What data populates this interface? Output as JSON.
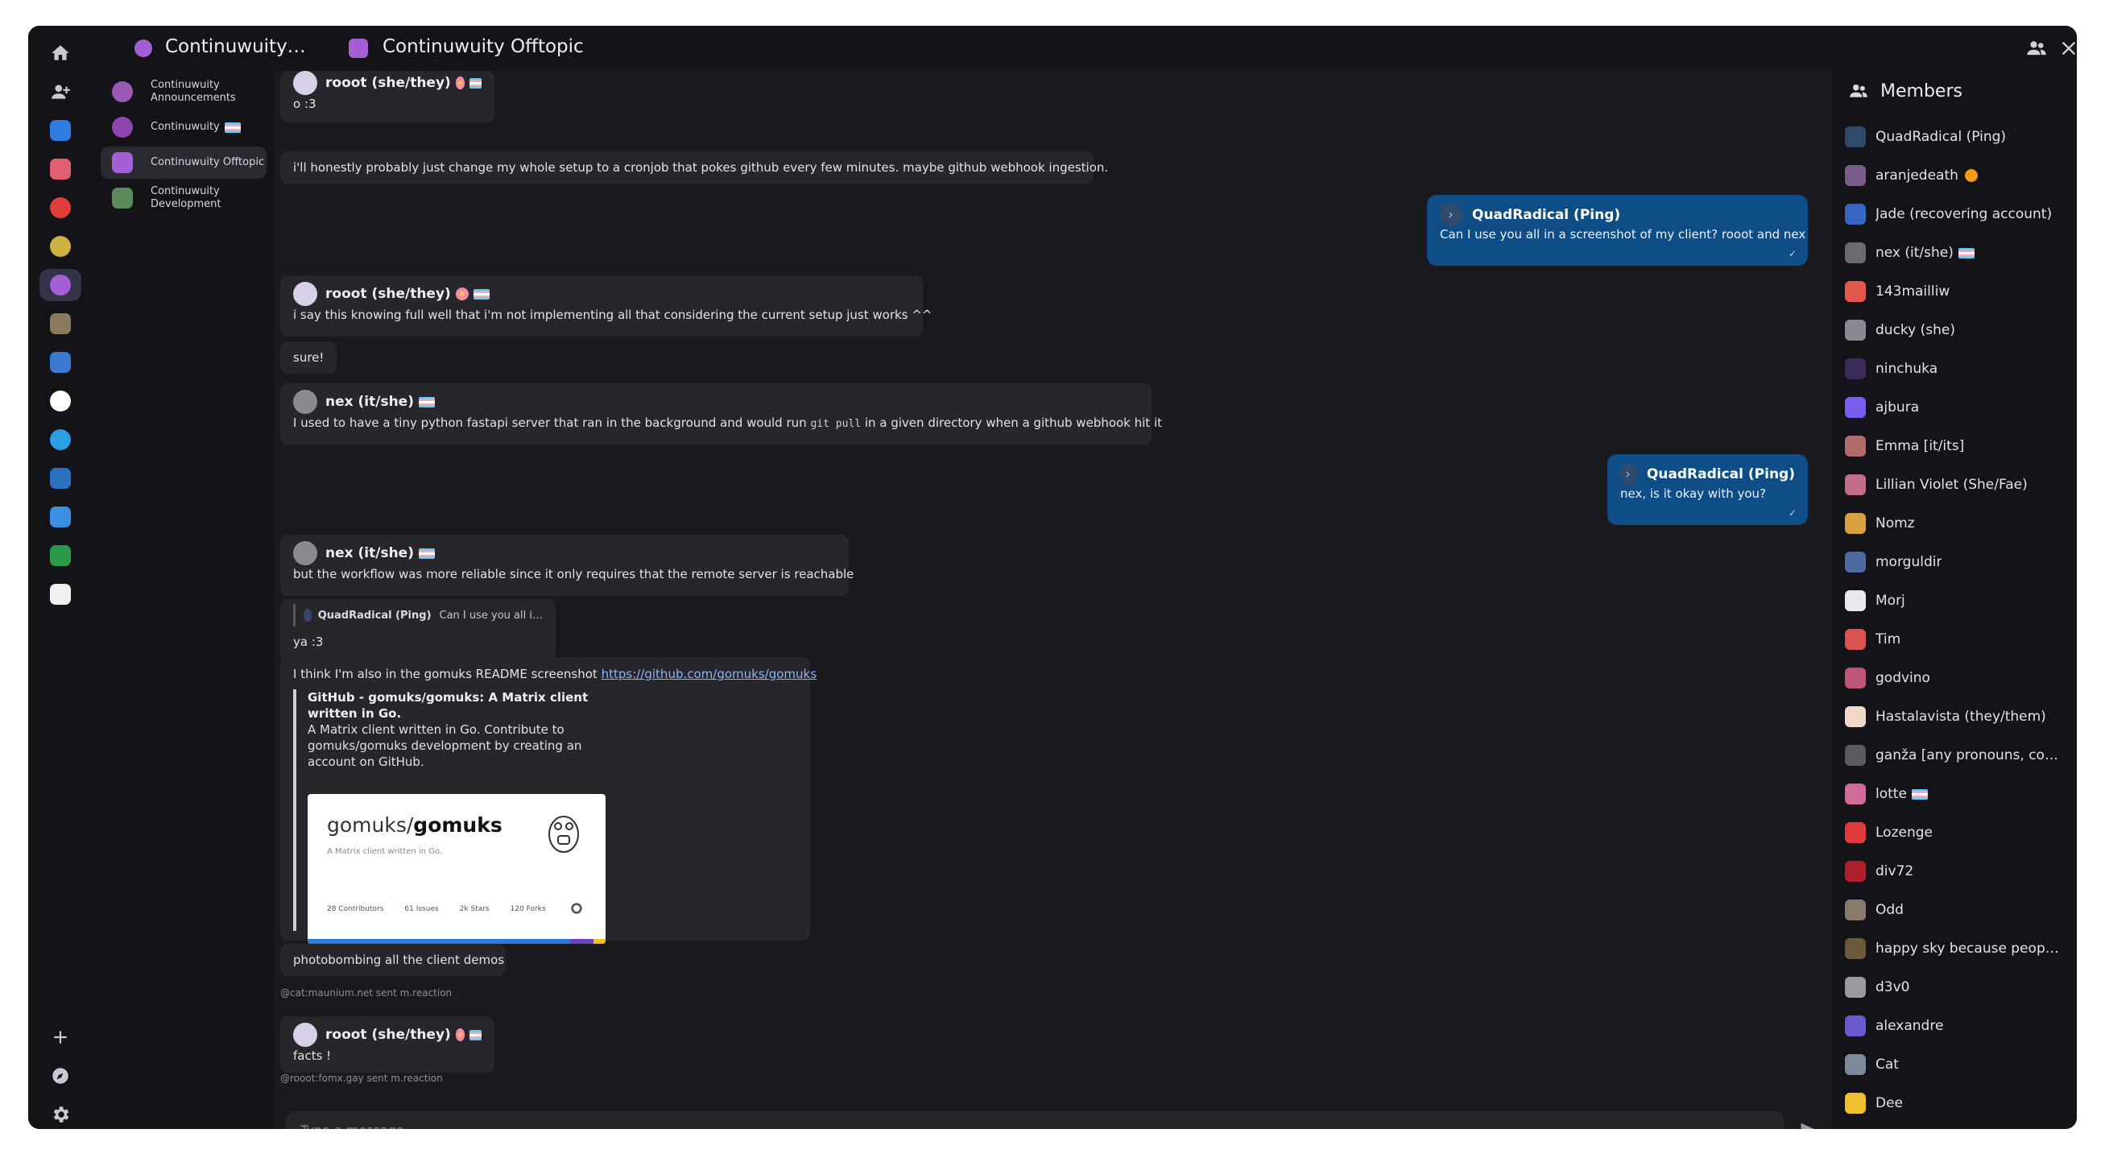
{
  "header": {
    "space_name": "Continuwuity…",
    "room_name": "Continuwuity Offtopic"
  },
  "rooms": [
    {
      "name": "Continuwuity Announcements",
      "color": "#9b59b6",
      "active": false
    },
    {
      "name": "Continuwuity",
      "color": "#8e44ad",
      "active": false
    },
    {
      "name": "Continuwuity Offtopic",
      "color": "#a55fd6",
      "active": true
    },
    {
      "name": "Continuwuity Development",
      "color": "#5c8a5c",
      "active": false
    }
  ],
  "messages": {
    "m1_sender": "rooot (she/they)",
    "m1_text": "o :3",
    "m2_text": "i'll honestly probably just change my whole setup to a cronjob that pokes github every few minutes. maybe github webhook ingestion.",
    "own1_sender": "QuadRadical (Ping)",
    "own1_text": "Can I use you all in a screenshot of my client? rooot and nex",
    "m3_sender": "rooot (she/they)",
    "m3_text": "i say this knowing full well that i'm not implementing all that considering the current setup just works ^^",
    "m4_text": "sure!",
    "m5_sender": "nex (it/she)",
    "m5_text_a": "I used to have a tiny python fastapi server that ran in the background and would run",
    "m5_code": "git pull",
    "m5_text_b": "in a given directory when a github webhook hit it",
    "own2_sender": "QuadRadical (Ping)",
    "own2_text": "nex, is it okay with you?",
    "m6_sender": "nex (it/she)",
    "m6_text": "but the workflow was more reliable since it only requires that the remote server is reachable",
    "m7_reply_name": "QuadRadical (Ping)",
    "m7_reply_text": "Can I use you all i…",
    "m7_text": "ya :3",
    "m8_text": "I think I'm also in the gomuks README screenshot",
    "m8_link": "https://github.com/gomuks/gomuks",
    "preview_title": "GitHub - gomuks/gomuks: A Matrix client written in Go.",
    "preview_desc": "A Matrix client written in Go. Contribute to gomuks/gomuks development by creating an account on GitHub.",
    "preview_img_owner": "gomuks/",
    "preview_img_repo": "gomuks",
    "preview_img_sub": "A Matrix client written in Go.",
    "preview_stats": [
      "28 Contributors",
      "61 Issues",
      "2k Stars",
      "120 Forks"
    ],
    "m9_text": "photobombing all the client demos",
    "notice1": "@cat:maunium.net sent m.reaction",
    "m10_sender": "rooot (she/they)",
    "m10_text": "facts !",
    "notice2": "@rooot:fomx.gay sent m.reaction"
  },
  "composer": {
    "placeholder": "Type a message"
  },
  "members": {
    "title": "Members",
    "list": [
      {
        "name": "QuadRadical (Ping)",
        "color": "#2f4a6a"
      },
      {
        "name": "aranjedeath",
        "color": "#7a5c8a"
      },
      {
        "name": "Jade (recovering account)",
        "color": "#3466c2"
      },
      {
        "name": "nex (it/she)",
        "color": "#6a6a70"
      },
      {
        "name": "143mailliw",
        "color": "#e2574c"
      },
      {
        "name": "ducky (she)",
        "color": "#8a8a96"
      },
      {
        "name": "ninchuka",
        "color": "#3b2a5a"
      },
      {
        "name": "ajbura",
        "color": "#7b5cf0"
      },
      {
        "name": "Emma [it/its]",
        "color": "#b06a6a"
      },
      {
        "name": "Lillian Violet (She/Fae)",
        "color": "#c46a8a"
      },
      {
        "name": "Nomz",
        "color": "#d8a040"
      },
      {
        "name": "morguldir",
        "color": "#4a6aa0"
      },
      {
        "name": "Morj",
        "color": "#e8e8ee"
      },
      {
        "name": "Tim",
        "color": "#d9534f"
      },
      {
        "name": "godvino",
        "color": "#c0557a"
      },
      {
        "name": "Hastalavista (they/them)",
        "color": "#f0d8c8"
      },
      {
        "name": "ganža [any pronouns, co…",
        "color": "#5a5a60"
      },
      {
        "name": "lotte",
        "color": "#d06a9a"
      },
      {
        "name": "Lozenge",
        "color": "#e03a3a"
      },
      {
        "name": "div72",
        "color": "#b0202a"
      },
      {
        "name": "Odd",
        "color": "#8a7a6a"
      },
      {
        "name": "happy sky because peop…",
        "color": "#6a5a3a"
      },
      {
        "name": "d3v0",
        "color": "#9a9aa0"
      },
      {
        "name": "alexandre",
        "color": "#6a5ad0"
      },
      {
        "name": "Cat",
        "color": "#7a8a9a"
      },
      {
        "name": "Dee",
        "color": "#f0c030"
      }
    ]
  },
  "servers": [
    {
      "name": "home",
      "color": ""
    },
    {
      "name": "direct-messages",
      "color": ""
    },
    {
      "name": "server-1",
      "color": "#2f7de1"
    },
    {
      "name": "server-2",
      "color": "#e06070"
    },
    {
      "name": "server-3",
      "color": "#e0403a"
    },
    {
      "name": "server-4",
      "color": "#d0b040"
    },
    {
      "name": "server-5",
      "color": "#a55fd6"
    },
    {
      "name": "server-6",
      "color": "#8a7a60"
    },
    {
      "name": "server-7",
      "color": "#3a7ad0"
    },
    {
      "name": "server-8",
      "color": "#ffffff"
    },
    {
      "name": "server-9",
      "color": "#2aa0e0"
    },
    {
      "name": "server-10",
      "color": "#2a70c0"
    },
    {
      "name": "server-11",
      "color": "#3a90e0"
    },
    {
      "name": "server-12",
      "color": "#2a9a4a"
    },
    {
      "name": "server-13",
      "color": "#f0f0f0"
    }
  ]
}
